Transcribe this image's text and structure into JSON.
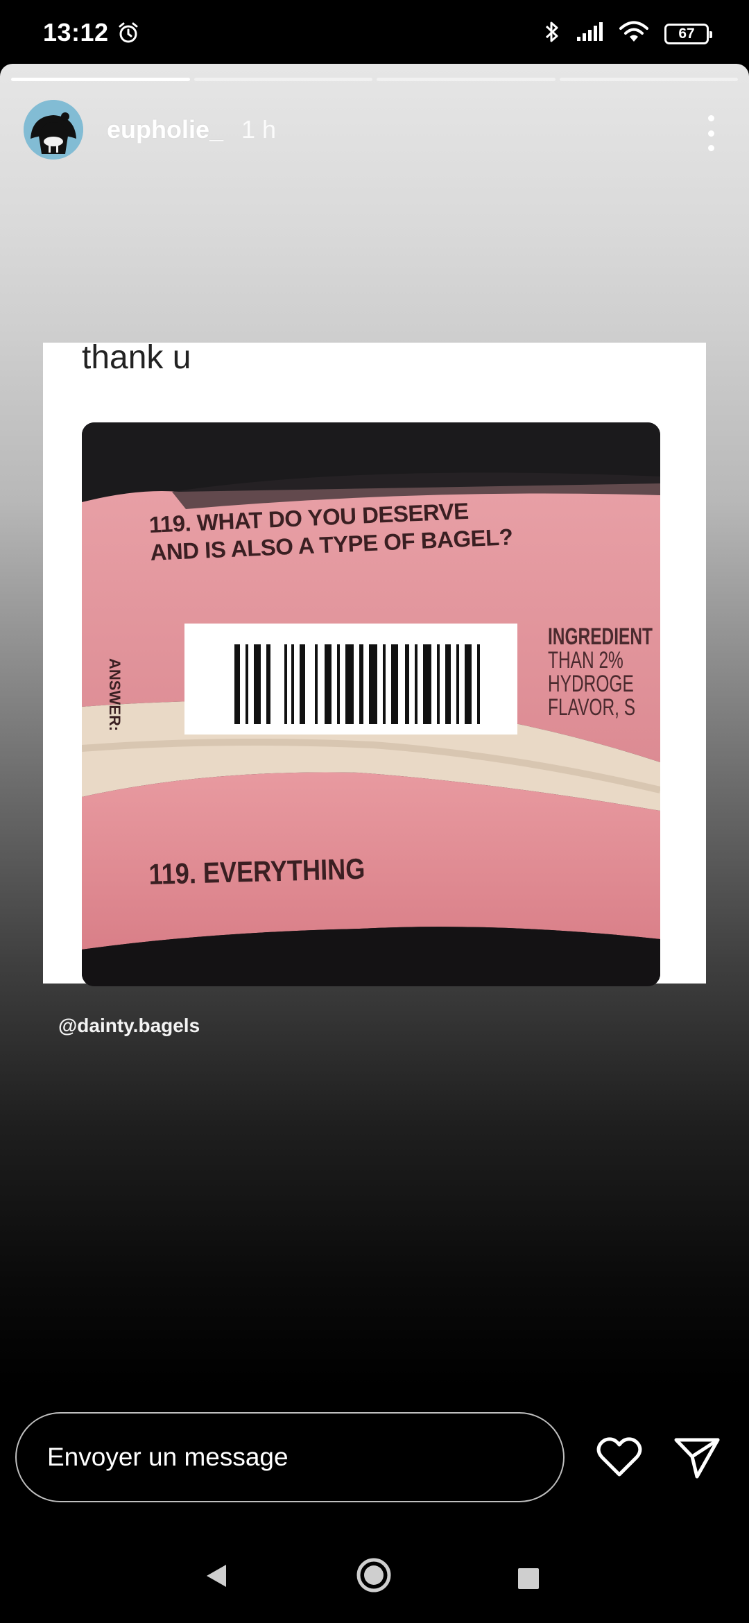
{
  "status_bar": {
    "time": "13:12",
    "battery": "67",
    "icons": [
      "alarm-icon",
      "bluetooth-icon",
      "signal-icon",
      "wifi-icon",
      "battery-icon"
    ]
  },
  "story": {
    "progress": [
      1,
      0,
      0,
      0
    ],
    "username": "eupholie_",
    "time_ago": "1 h",
    "menu_icon": "more-vertical-icon",
    "post": {
      "caption": "thank u",
      "photo": {
        "question_line1": "119. WHAT DO YOU DESERVE",
        "question_line2": "AND IS ALSO A TYPE OF BAGEL?",
        "answer_side_label": "ANSWER:",
        "ingredients": [
          "INGREDIENT",
          "THAN 2%",
          "HYDROGE",
          "FLAVOR, S"
        ],
        "answer": "119. EVERYTHING"
      }
    },
    "mention": "@dainty.bagels"
  },
  "reply_bar": {
    "placeholder": "Envoyer un message",
    "like_icon": "heart-icon",
    "send_icon": "send-icon"
  },
  "nav_bar": {
    "icons": [
      "back-icon",
      "home-icon",
      "recents-icon"
    ]
  },
  "colors": {
    "background": "#000000",
    "wrapper_pink": "#e9a2a6",
    "text_white": "#ffffff"
  }
}
